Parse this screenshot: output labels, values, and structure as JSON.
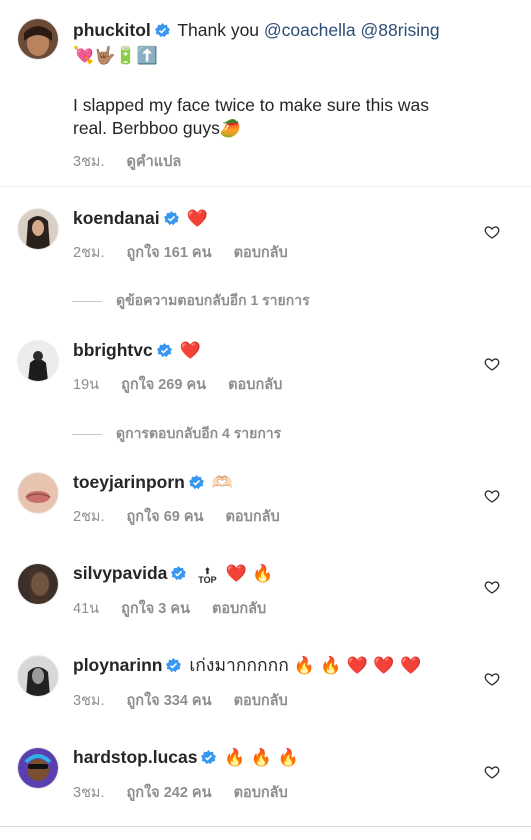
{
  "post": {
    "username": "phuckitol",
    "caption_prefix": "Thank you",
    "mention1": "@coachella",
    "mention2": "@88rising",
    "emoji_line": "💘🤟🏽🔋⬆️",
    "caption_body_1": "I slapped my face twice to make sure this was",
    "caption_body_2": "real. Berbboo guys",
    "caption_emoji": "🥭",
    "time": "3ชม.",
    "translate": "ดูคำแปล"
  },
  "comments": [
    {
      "username": "koendanai",
      "text": "",
      "emoji": "❤️",
      "time": "2ชม.",
      "likes": "ถูกใจ 161 คน",
      "reply": "ตอบกลับ"
    },
    {
      "username": "bbrightvc",
      "text": "",
      "emoji": "❤️",
      "time": "19น",
      "likes": "ถูกใจ 269 คน",
      "reply": "ตอบกลับ"
    },
    {
      "username": "toeyjarinporn",
      "text": "",
      "emoji": "🫶🏻",
      "time": "2ชม.",
      "likes": "ถูกใจ 69 คน",
      "reply": "ตอบกลับ"
    },
    {
      "username": "silvypavida",
      "text": "",
      "emoji": "❤️ 🔥",
      "time": "41น",
      "likes": "ถูกใจ 3 คน",
      "reply": "ตอบกลับ",
      "top_label": "TOP"
    },
    {
      "username": "ploynarinn",
      "text": "เก่งมากกกกก",
      "emoji": "🔥 🔥 ❤️ ❤️ ❤️",
      "time": "3ชม.",
      "likes": "ถูกใจ 334 คน",
      "reply": "ตอบกลับ"
    },
    {
      "username": "hardstop.lucas",
      "text": "",
      "emoji": "🔥 🔥 🔥",
      "time": "3ชม.",
      "likes": "ถูกใจ 242 คน",
      "reply": "ตอบกลับ"
    }
  ],
  "view_replies": [
    "ดูข้อความตอบกลับอีก 1 รายการ",
    "ดูการตอบกลับอีก 4 รายการ"
  ],
  "colors": {
    "mention": "#2d4d76",
    "verified": "#3897f0",
    "meta": "#8e8e8e"
  },
  "icons": {
    "verified": "verified-badge-icon",
    "like": "heart-outline-icon"
  }
}
